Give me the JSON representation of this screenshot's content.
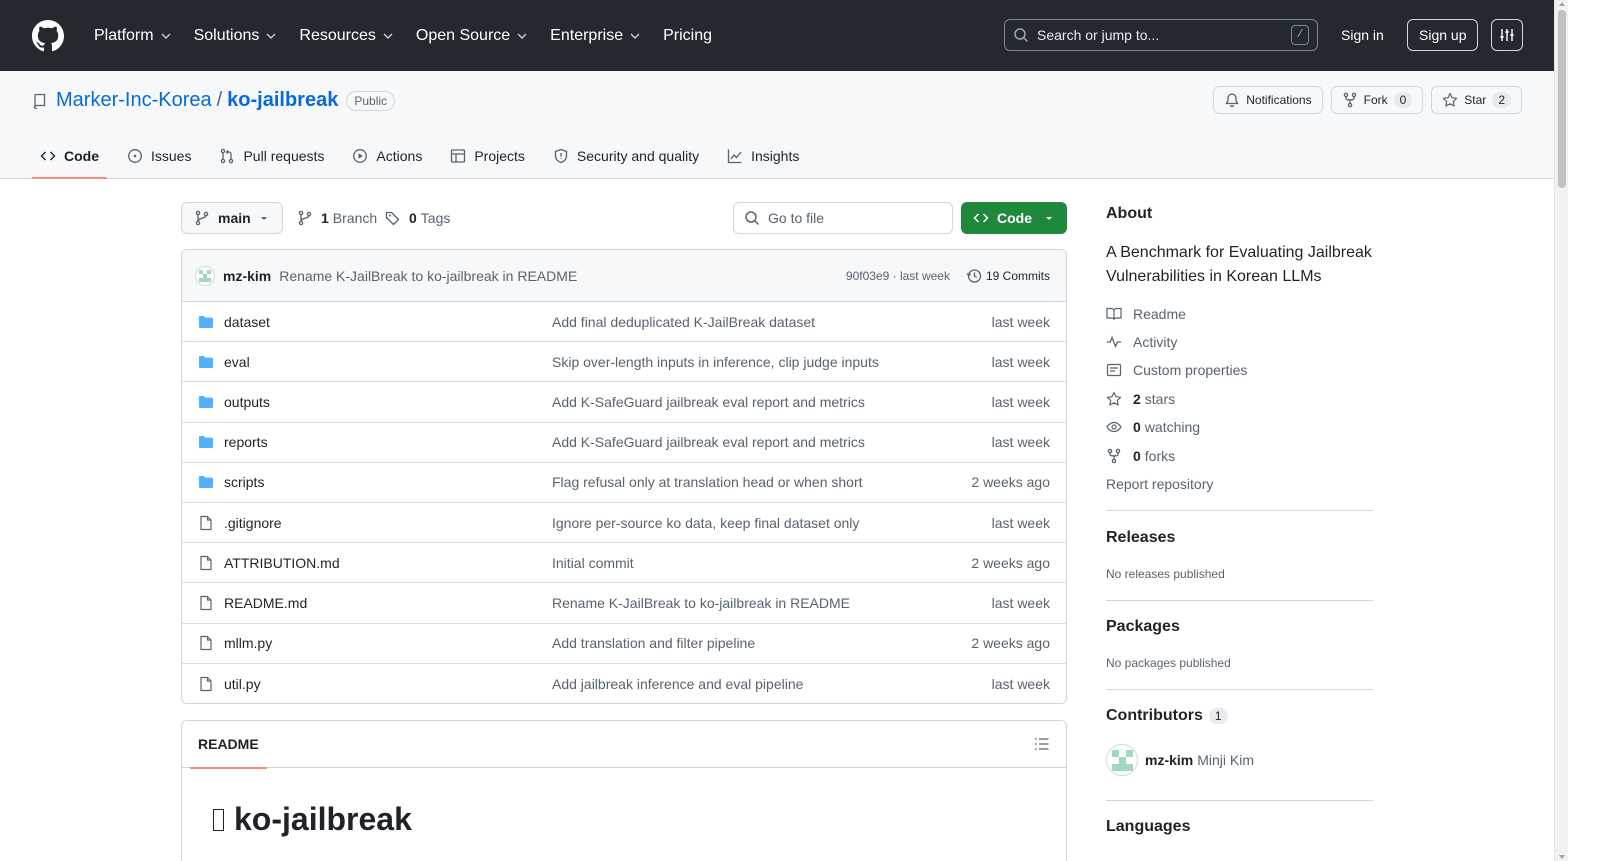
{
  "nav": {
    "items": [
      "Platform",
      "Solutions",
      "Resources",
      "Open Source",
      "Enterprise",
      "Pricing"
    ],
    "search_placeholder": "Search or jump to...",
    "search_shortcut": "/",
    "sign_in": "Sign in",
    "sign_up": "Sign up"
  },
  "repo": {
    "owner": "Marker-Inc-Korea",
    "separator": "/",
    "name": "ko-jailbreak",
    "visibility": "Public",
    "notifications_label": "Notifications",
    "fork_label": "Fork",
    "fork_count": "0",
    "star_label": "Star",
    "star_count": "2",
    "tabs": [
      "Code",
      "Issues",
      "Pull requests",
      "Actions",
      "Projects",
      "Security and quality",
      "Insights"
    ]
  },
  "toolbar": {
    "branch": "main",
    "branch_count": "1",
    "branch_label": "Branch",
    "tag_count": "0",
    "tag_label": "Tags",
    "goto_placeholder": "Go to file",
    "code_label": "Code"
  },
  "commit": {
    "author": "mz-kim",
    "message": "Rename K-JailBreak to ko-jailbreak in README",
    "hash_and_time": "90f03e9 · last week",
    "commits_label": "19 Commits"
  },
  "files": [
    {
      "name": "dataset",
      "type": "dir",
      "message": "Add final deduplicated K-JailBreak dataset",
      "date": "last week"
    },
    {
      "name": "eval",
      "type": "dir",
      "message": "Skip over-length inputs in inference, clip judge inputs",
      "date": "last week"
    },
    {
      "name": "outputs",
      "type": "dir",
      "message": "Add K-SafeGuard jailbreak eval report and metrics",
      "date": "last week"
    },
    {
      "name": "reports",
      "type": "dir",
      "message": "Add K-SafeGuard jailbreak eval report and metrics",
      "date": "last week"
    },
    {
      "name": "scripts",
      "type": "dir",
      "message": "Flag refusal only at translation head or when short",
      "date": "2 weeks ago"
    },
    {
      "name": ".gitignore",
      "type": "file",
      "message": "Ignore per-source ko data, keep final dataset only",
      "date": "last week"
    },
    {
      "name": "ATTRIBUTION.md",
      "type": "file",
      "message": "Initial commit",
      "date": "2 weeks ago"
    },
    {
      "name": "README.md",
      "type": "file",
      "message": "Rename K-JailBreak to ko-jailbreak in README",
      "date": "last week"
    },
    {
      "name": "mllm.py",
      "type": "file",
      "message": "Add translation and filter pipeline",
      "date": "2 weeks ago"
    },
    {
      "name": "util.py",
      "type": "file",
      "message": "Add jailbreak inference and eval pipeline",
      "date": "last week"
    }
  ],
  "readme": {
    "tab_label": "README",
    "heading": "ko-jailbreak"
  },
  "about": {
    "title": "About",
    "description": "A Benchmark for Evaluating Jailbreak Vulnerabilities in Korean LLMs",
    "links": {
      "readme": "Readme",
      "activity": "Activity",
      "custom_properties": "Custom properties",
      "stars_count": "2",
      "stars_label": "stars",
      "watching_count": "0",
      "watching_label": "watching",
      "forks_count": "0",
      "forks_label": "forks",
      "report": "Report repository"
    }
  },
  "releases": {
    "title": "Releases",
    "empty": "No releases published"
  },
  "packages": {
    "title": "Packages",
    "empty": "No packages published"
  },
  "contributors": {
    "title": "Contributors",
    "count": "1",
    "login": "mz-kim",
    "name": "Minji Kim"
  },
  "languages": {
    "title": "Languages"
  },
  "colors": {
    "header_bg": "#24292f",
    "link": "#0969da",
    "primary_button": "#1f883d",
    "tab_underline": "#fd8c73",
    "folder": "#54aeff"
  }
}
